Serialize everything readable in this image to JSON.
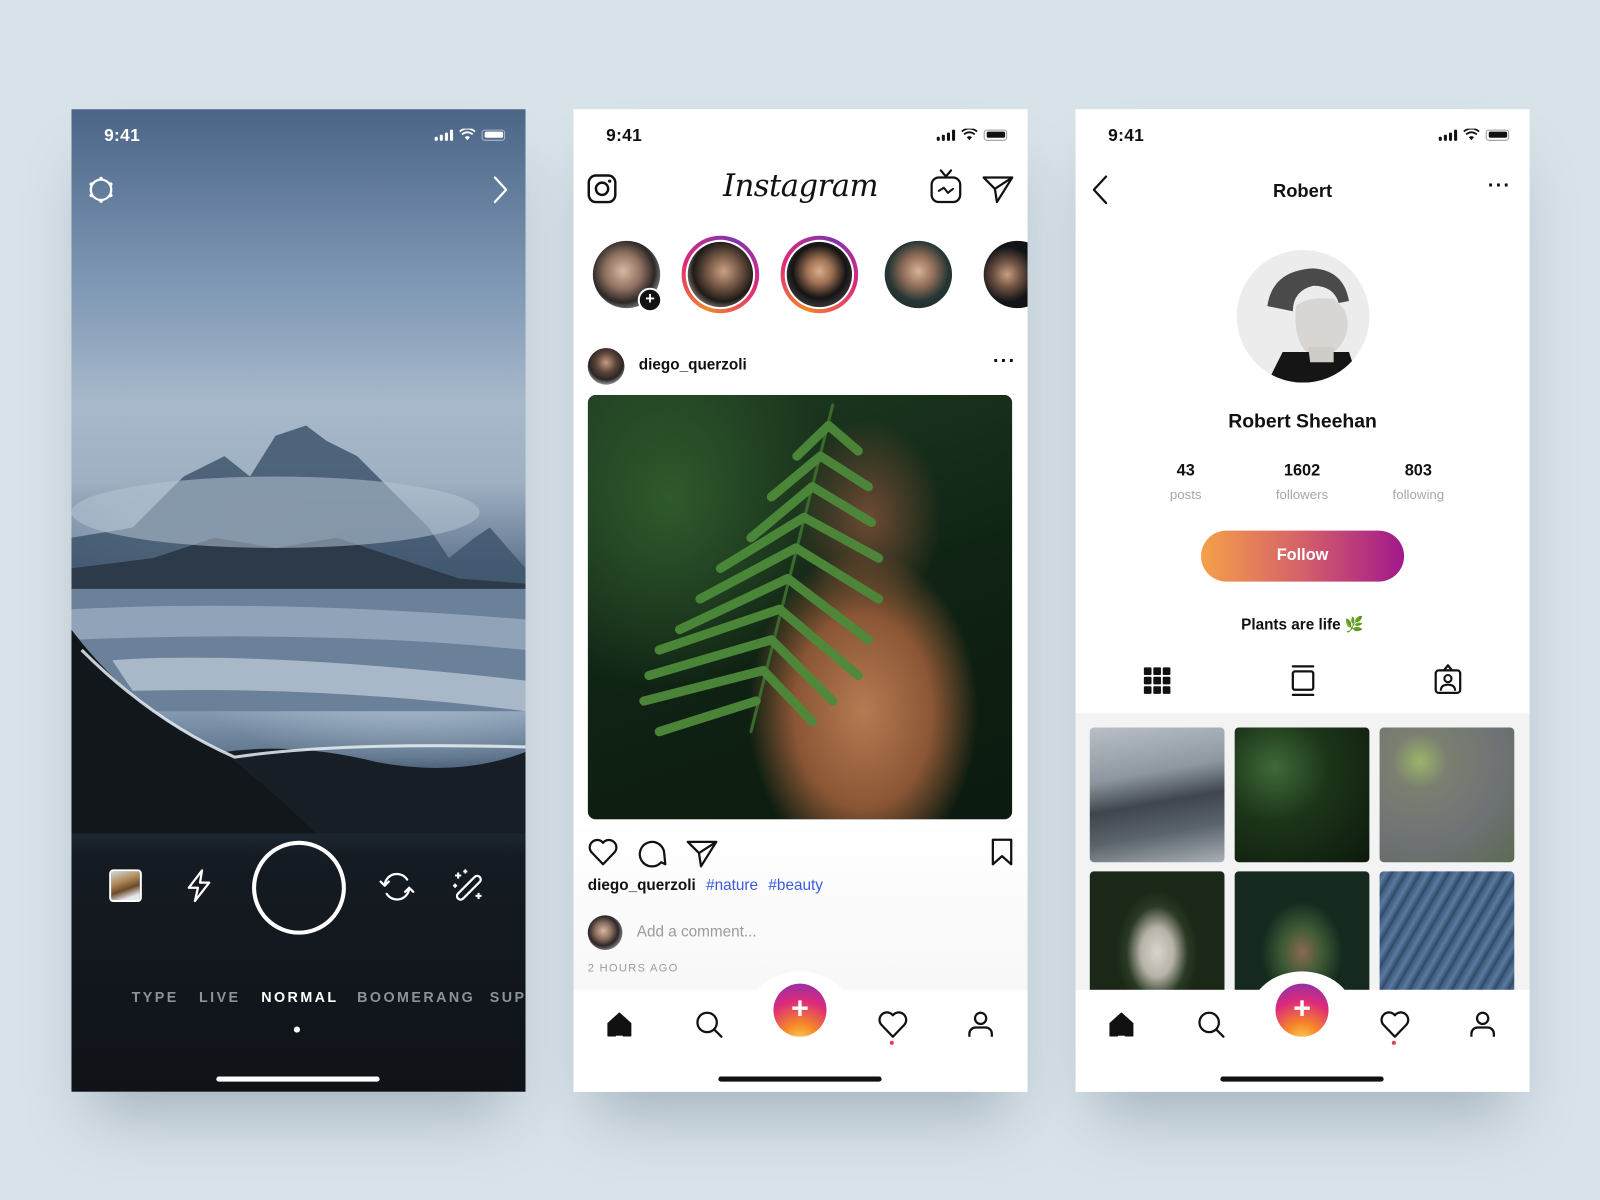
{
  "status_bar": {
    "time": "9:41"
  },
  "camera": {
    "modes": [
      "TYPE",
      "LIVE",
      "NORMAL",
      "BOOMERANG",
      "SUP"
    ],
    "active_mode": "NORMAL",
    "icons": [
      "settings-icon",
      "chevron-right-icon",
      "gallery-thumbnail",
      "flash-icon",
      "shutter-button",
      "switch-camera-icon",
      "effects-wand-icon"
    ]
  },
  "feed": {
    "logo": "Instagram",
    "stories": [
      {
        "user": "your-story",
        "has_ring": false,
        "add_badge": "+"
      },
      {
        "user": "story-2",
        "has_ring": true
      },
      {
        "user": "story-3",
        "has_ring": true
      },
      {
        "user": "story-4",
        "has_ring": false
      },
      {
        "user": "story-5",
        "has_ring": false
      }
    ],
    "post": {
      "username": "diego_querzoli",
      "more": "···",
      "caption_user": "diego_querzoli",
      "hashtags": [
        "#nature",
        "#beauty"
      ],
      "comment_placeholder": "Add a comment...",
      "time_ago": "2 HOURS AGO"
    }
  },
  "profile": {
    "nav_title": "Robert",
    "more": "···",
    "full_name": "Robert Sheehan",
    "stats": [
      {
        "value": "43",
        "label": "posts"
      },
      {
        "value": "1602",
        "label": "followers"
      },
      {
        "value": "803",
        "label": "following"
      }
    ],
    "follow_label": "Follow",
    "bio": "Plants are life 🌿",
    "tabs": [
      "grid-view",
      "feed-view",
      "tagged-view"
    ],
    "grid": [
      "misty-mountain-coast",
      "fern-leaves",
      "avocados-matcha",
      "statue-garden",
      "fern-portrait",
      "blue-palm-leaves"
    ]
  },
  "tabbar": {
    "add_label": "+"
  },
  "colors": {
    "background": "#d8e2e9",
    "hashtag": "#3b5bdb",
    "follow_gradient_start": "#f4a04a",
    "follow_gradient_end": "#a2188c",
    "notification_dot": "#e0405a"
  }
}
